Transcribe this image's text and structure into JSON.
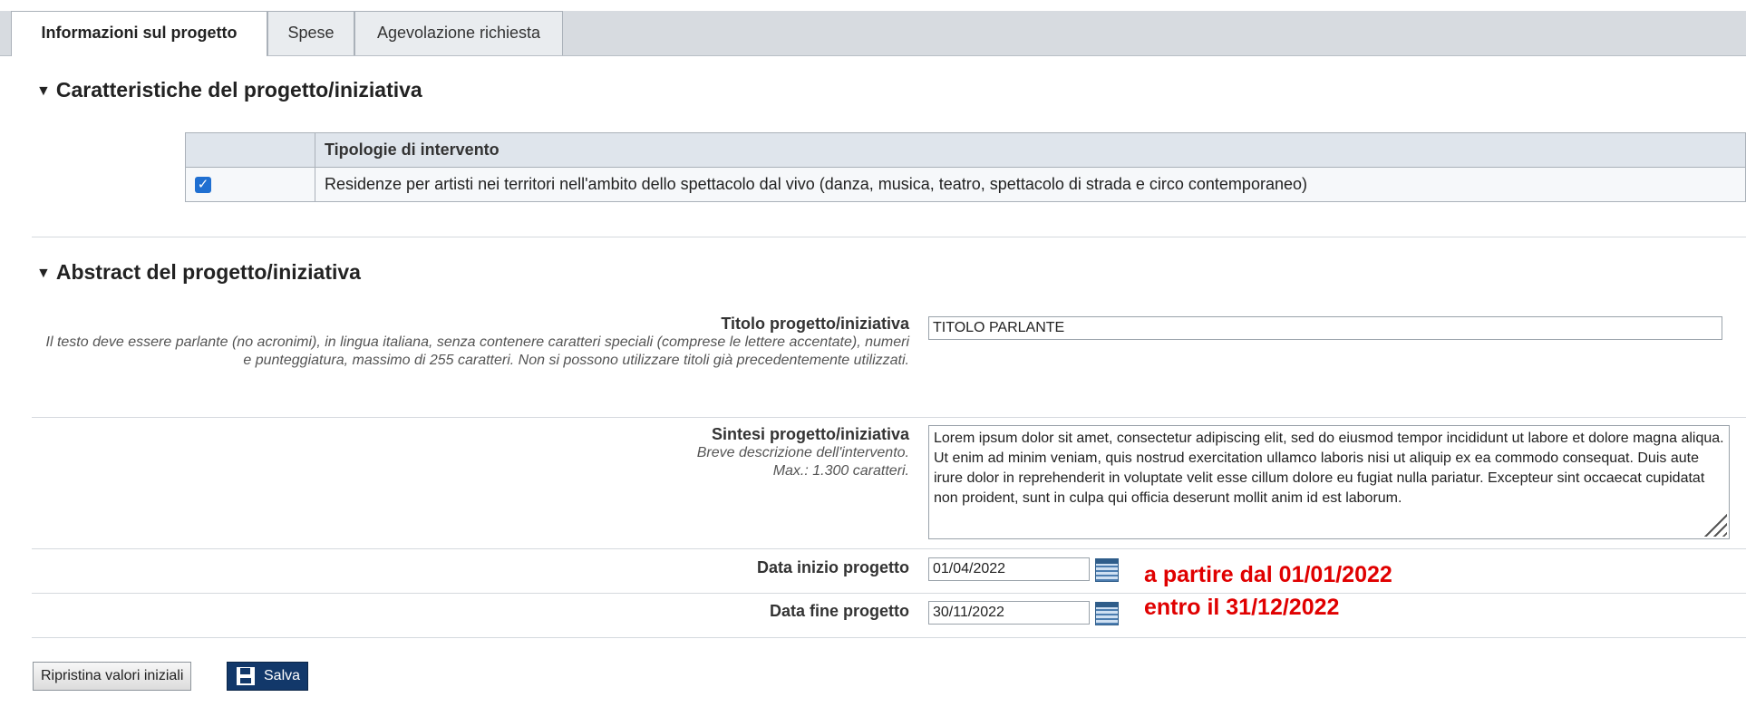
{
  "tabs": [
    {
      "label": "Informazioni sul progetto",
      "active": true
    },
    {
      "label": "Spese",
      "active": false
    },
    {
      "label": "Agevolazione richiesta",
      "active": false
    }
  ],
  "section1": {
    "title": "Caratteristiche del progetto/iniziativa",
    "table_header": "Tipologie di intervento",
    "rows": [
      {
        "checked": true,
        "text": "Residenze per artisti nei territori nell'ambito dello spettacolo dal vivo (danza, musica, teatro, spettacolo di strada e circo contemporaneo)"
      }
    ]
  },
  "section2": {
    "title": "Abstract del progetto/iniziativa",
    "titolo": {
      "label": "Titolo progetto/iniziativa",
      "help": "Il testo deve essere parlante (no acronimi), in lingua italiana, senza contenere caratteri speciali (comprese le lettere accentate), numeri e punteggiatura, massimo di 255 caratteri. Non si possono utilizzare titoli già precedentemente utilizzati.",
      "value": "TITOLO PARLANTE"
    },
    "sintesi": {
      "label": "Sintesi progetto/iniziativa",
      "help1": "Breve descrizione dell'intervento.",
      "help2": "Max.: 1.300 caratteri.",
      "value": "Lorem ipsum dolor sit amet, consectetur adipiscing elit, sed do eiusmod tempor incididunt ut labore et dolore magna aliqua. Ut enim ad minim veniam, quis nostrud exercitation ullamco laboris nisi ut aliquip ex ea commodo consequat. Duis aute irure dolor in reprehenderit in voluptate velit esse cillum dolore eu fugiat nulla pariatur. Excepteur sint occaecat cupidatat non proident, sunt in culpa qui officia deserunt mollit anim id est laborum."
    },
    "data_inizio": {
      "label": "Data inizio progetto",
      "value": "01/04/2022",
      "note": "a partire dal 01/01/2022"
    },
    "data_fine": {
      "label": "Data fine progetto",
      "value": "30/11/2022",
      "note": "entro il 31/12/2022"
    }
  },
  "buttons": {
    "reset": "Ripristina valori iniziali",
    "save": "Salva"
  },
  "colors": {
    "note": "#e00000",
    "save_button": "#12386a",
    "checkbox": "#1f6fd1"
  }
}
